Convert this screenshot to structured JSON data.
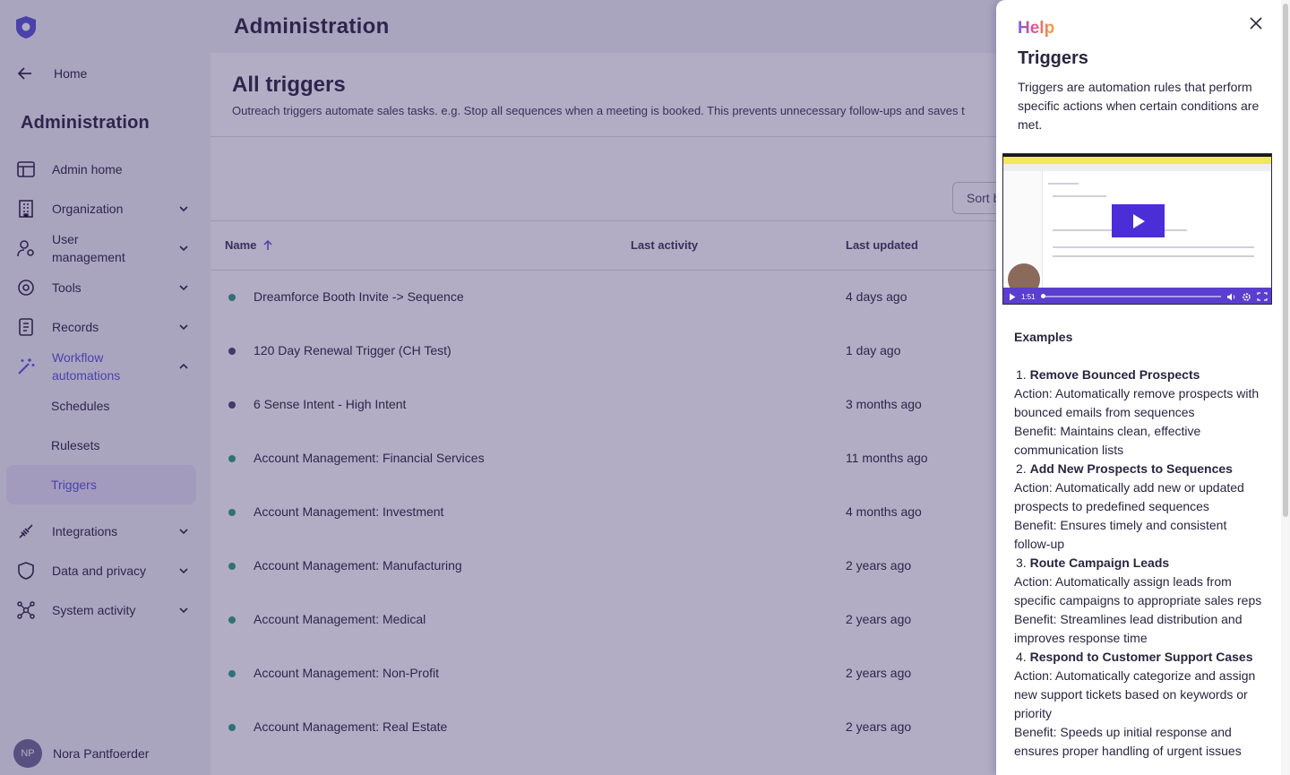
{
  "sidebar": {
    "home_label": "Home",
    "title": "Administration",
    "items": [
      {
        "label": "Admin home",
        "icon": "layout-icon"
      },
      {
        "label": "Organization",
        "icon": "building-icon"
      },
      {
        "label": "User management",
        "icon": "user-gear-icon"
      },
      {
        "label": "Tools",
        "icon": "tools-icon"
      },
      {
        "label": "Records",
        "icon": "records-icon"
      },
      {
        "label": "Workflow automations",
        "icon": "wand-icon"
      },
      {
        "label": "Integrations",
        "icon": "plug-icon"
      },
      {
        "label": "Data and privacy",
        "icon": "shield-icon"
      },
      {
        "label": "System activity",
        "icon": "network-icon"
      }
    ],
    "sub_items": [
      "Schedules",
      "Rulesets",
      "Triggers"
    ],
    "active_sub": "Triggers",
    "user": {
      "initials": "NP",
      "name": "Nora Pantfoerder"
    }
  },
  "main": {
    "page_title": "Administration",
    "card_title": "All triggers",
    "card_desc": "Outreach triggers automate sales tasks. e.g. Stop all sequences when a meeting is booked. This prevents unnecessary follow-ups and saves t",
    "sort_label": "Sort b",
    "columns": {
      "name": "Name",
      "last_activity": "Last activity",
      "last_updated": "Last updated"
    },
    "rows": [
      {
        "name": "Dreamforce Booth Invite -> Sequence",
        "updated": "4 days ago",
        "status": "active"
      },
      {
        "name": "120 Day Renewal Trigger (CH Test)",
        "updated": "1 day ago",
        "status": "inactive"
      },
      {
        "name": "6 Sense Intent - High Intent",
        "updated": "3 months ago",
        "status": "inactive"
      },
      {
        "name": "Account Management: Financial Services",
        "updated": "11 months ago",
        "status": "active"
      },
      {
        "name": "Account Management: Investment",
        "updated": "4 months ago",
        "status": "active"
      },
      {
        "name": "Account Management: Manufacturing",
        "updated": "2 years ago",
        "status": "active"
      },
      {
        "name": "Account Management: Medical",
        "updated": "2 years ago",
        "status": "active"
      },
      {
        "name": "Account Management: Non-Profit",
        "updated": "2 years ago",
        "status": "active"
      },
      {
        "name": "Account Management: Real Estate",
        "updated": "2 years ago",
        "status": "active"
      }
    ]
  },
  "help": {
    "tag": "Help",
    "title": "Triggers",
    "intro": "Triggers are automation rules that perform specific actions when certain conditions are met.",
    "video": {
      "time": "1:51"
    },
    "examples_heading": "Examples",
    "examples": [
      {
        "num": "1.",
        "title": "Remove Bounced Prospects",
        "action": "Action: Automatically remove prospects with bounced emails from sequences",
        "benefit": "Benefit: Maintains clean, effective communication lists"
      },
      {
        "num": "2.",
        "title": "Add New Prospects to Sequences",
        "action": "Action: Automatically add new or updated prospects to predefined sequences",
        "benefit": "Benefit: Ensures timely and consistent follow-up"
      },
      {
        "num": "3.",
        "title": "Route Campaign Leads",
        "action": "Action: Automatically assign leads from specific campaigns to appropriate sales reps",
        "benefit": "Benefit: Streamlines lead distribution and improves response time"
      },
      {
        "num": "4.",
        "title": "Respond to Customer Support Cases",
        "action": "Action: Automatically categorize and assign new support tickets based on keywords or priority",
        "benefit": "Benefit: Speeds up initial response and ensures proper handling of urgent issues"
      }
    ]
  },
  "colors": {
    "accent": "#5951d6",
    "status_active": "#2e9e86",
    "status_inactive": "#4a4470",
    "overlay": "#342864"
  }
}
